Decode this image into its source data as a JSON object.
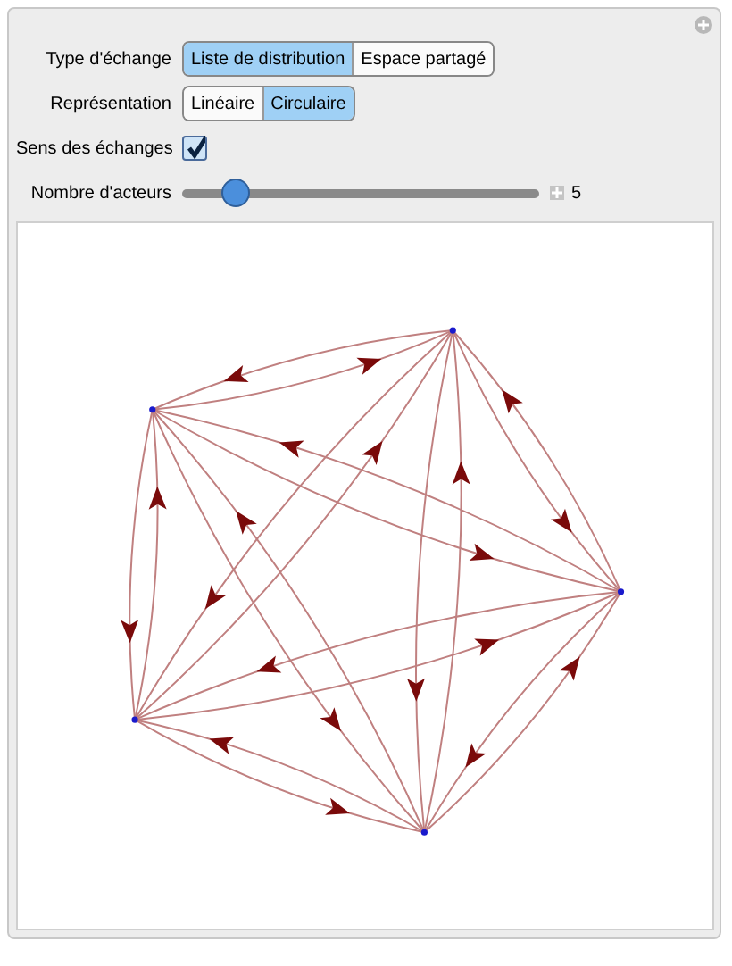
{
  "controls": [
    {
      "kind": "segmented",
      "label": "Type d'échange",
      "options": [
        {
          "label": "Liste de distribution",
          "selected": true
        },
        {
          "label": "Espace partagé",
          "selected": false
        }
      ]
    },
    {
      "kind": "segmented",
      "label": "Représentation",
      "options": [
        {
          "label": "Linéaire",
          "selected": false
        },
        {
          "label": "Circulaire",
          "selected": true
        }
      ]
    },
    {
      "kind": "checkbox",
      "label": "Sens des échanges",
      "checked": true
    },
    {
      "kind": "slider",
      "label": "Nombre d'acteurs",
      "level": 0.15,
      "value": "5"
    }
  ]
}
